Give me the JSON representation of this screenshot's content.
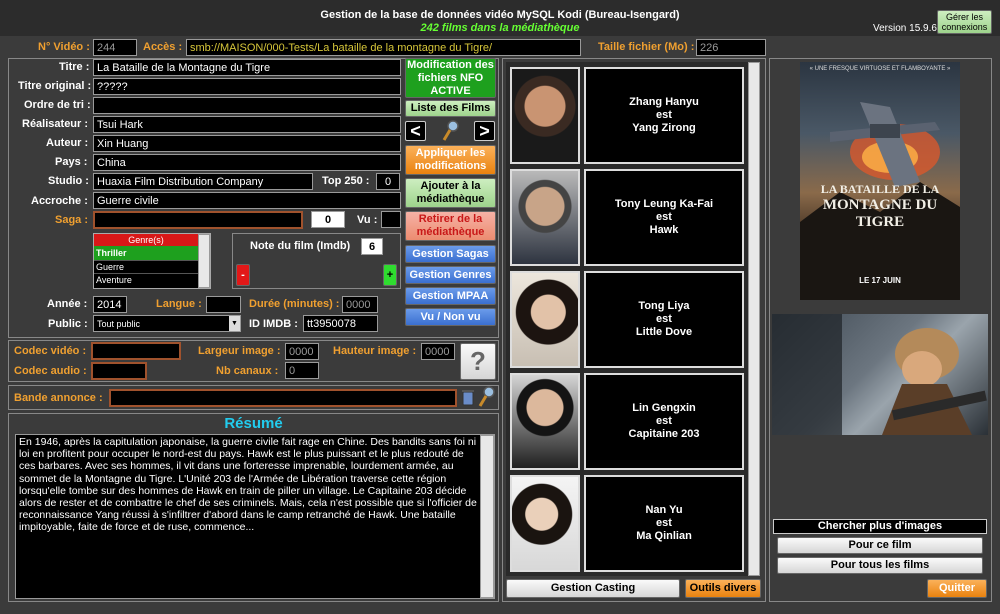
{
  "header": {
    "title": "Gestion de la base de données vidéo MySQL Kodi (Bureau-Isengard)",
    "subtitle": "242 films dans la médiathèque",
    "version": "Version 15.9.6",
    "connections_button": "Gérer les connexions"
  },
  "top": {
    "video_no_label": "N° Vidéo :",
    "video_no": "244",
    "access_label": "Accès :",
    "access_path": "smb://MAISON/000-Tests/La bataille de la montagne du Tigre/",
    "filesize_label": "Taille fichier (Mo) :",
    "filesize": "226"
  },
  "fields": {
    "title_label": "Titre :",
    "title": "La Bataille de la Montagne du Tigre",
    "original_title_label": "Titre original :",
    "original_title": "?????",
    "sort_label": "Ordre de tri :",
    "sort": "",
    "director_label": "Réalisateur :",
    "director": "Tsui Hark",
    "author_label": "Auteur :",
    "author": "Xin Huang",
    "country_label": "Pays :",
    "country": "China",
    "studio_label": "Studio :",
    "studio": "Huaxia Film Distribution Company",
    "top250_label": "Top 250 :",
    "top250": "0",
    "tagline_label": "Accroche :",
    "tagline": "Guerre civile",
    "saga_label": "Saga :",
    "saga": "",
    "saga_no": "0",
    "seen_label": "Vu :",
    "seen": ""
  },
  "genres": {
    "header": "Genre(s)",
    "items": [
      "Thriller",
      "Guerre",
      "Aventure"
    ]
  },
  "rating": {
    "label": "Note du film (Imdb)",
    "value": "6",
    "minus": "-",
    "plus": "+"
  },
  "meta": {
    "year_label": "Année :",
    "year": "2014",
    "language_label": "Langue :",
    "language": "",
    "duration_label": "Durée (minutes) :",
    "duration": "0000",
    "public_label": "Public :",
    "public": "Tout public",
    "imdb_label": "ID IMDB :",
    "imdb": "tt3950078"
  },
  "codec": {
    "video_label": "Codec vidéo :",
    "video": "",
    "audio_label": "Codec audio :",
    "audio": "",
    "width_label": "Largeur image :",
    "width": "0000",
    "height_label": "Hauteur image :",
    "height": "0000",
    "channels_label": "Nb canaux :",
    "channels": "0",
    "help": "?"
  },
  "trailer": {
    "label": "Bande annonce :",
    "value": ""
  },
  "summary": {
    "title": "Résumé",
    "text": "En 1946, après la capitulation japonaise, la guerre civile fait rage en Chine. Des bandits sans foi ni loi en profitent pour occuper le nord-est du pays. Hawk est le plus puissant et le plus redouté de ces barbares. Avec ses hommes, il vit dans une forteresse imprenable, lourdement armée, au sommet de la Montagne du Tigre. L'Unité 203 de l'Armée de Libération traverse cette région lorsqu'elle tombe sur des hommes de Hawk en train de piller un village. Le Capitaine 203 décide alors de rester et de combattre le chef de ses criminels. Mais, cela n'est possible que si l'officier de reconnaissance Yang réussi à s'infiltrer d'abord dans le camp retranché de Hawk. Une bataille impitoyable, faite de force et de ruse, commence..."
  },
  "actions": {
    "nfo": "Modification des fichiers NFO ACTIVE",
    "list": "Liste des Films",
    "prev": "<",
    "next": ">",
    "apply": "Appliquer les modifications",
    "add": "Ajouter à la médiathèque",
    "remove": "Retirer de la médiathèque",
    "sagas": "Gestion Sagas",
    "genres": "Gestion Genres",
    "mpaa": "Gestion MPAA",
    "seen": "Vu / Non vu"
  },
  "cast": [
    {
      "actor": "Zhang Hanyu",
      "est": "est",
      "role": "Yang Zirong"
    },
    {
      "actor": "Tony Leung Ka-Fai",
      "est": "est",
      "role": "Hawk"
    },
    {
      "actor": "Tong Liya",
      "est": "est",
      "role": "Little Dove"
    },
    {
      "actor": "Lin Gengxin",
      "est": "est",
      "role": "Capitaine 203"
    },
    {
      "actor": "Nan Yu",
      "est": "est",
      "role": "Ma Qinlian"
    }
  ],
  "bottom": {
    "casting": "Gestion Casting",
    "tools": "Outils divers",
    "more_images": "Chercher plus d'images",
    "for_this": "Pour ce film",
    "for_all": "Pour tous les films",
    "quit": "Quitter"
  },
  "poster": {
    "tagline": "« UNE FRESQUE VIRTUOSE ET FLAMBOYANTE »",
    "title1": "LA BATAILLE DE LA",
    "title2": "MONTAGNE DU TIGRE",
    "date": "LE 17 JUIN"
  },
  "colors": {
    "accent_orange": "#f0a030",
    "green": "#1ea01e",
    "blue": "#3a6fd0",
    "cyan": "#22ccee",
    "lime": "#66ff33"
  }
}
